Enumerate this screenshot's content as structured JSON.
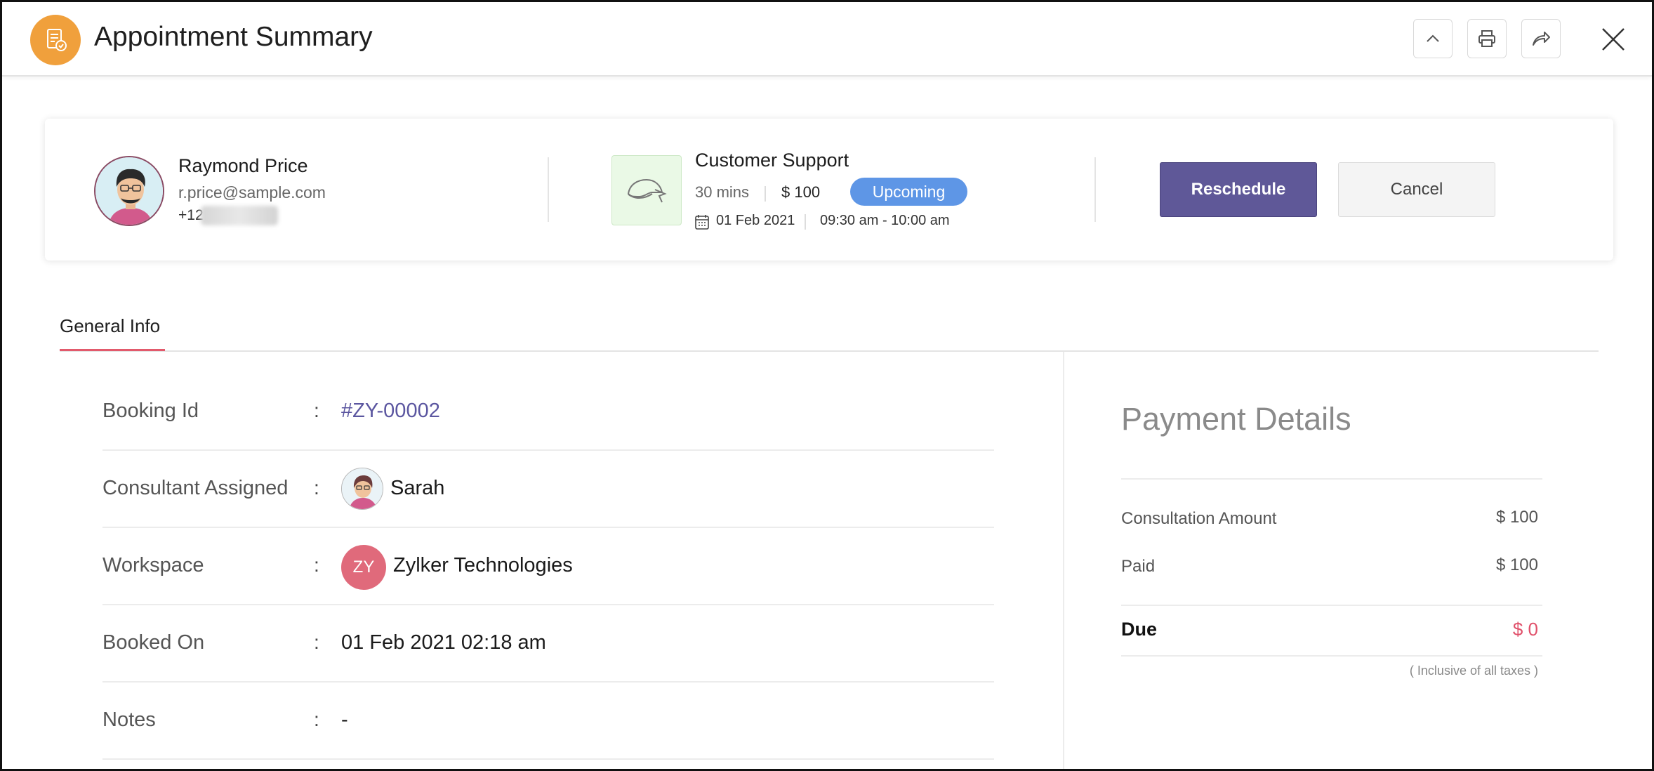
{
  "header": {
    "title": "Appointment Summary",
    "icon": "appointment-doc-icon",
    "accent_color": "#f0a03c"
  },
  "customer": {
    "name": "Raymond Price",
    "email": "r.price@sample.com",
    "phone_prefix": "+12"
  },
  "service": {
    "name": "Customer Support",
    "duration": "30 mins",
    "price": "$ 100",
    "status": "Upcoming",
    "status_color": "#5e96e6",
    "date": "01 Feb 2021",
    "time": "09:30 am - 10:00 am"
  },
  "actions": {
    "reschedule_label": "Reschedule",
    "cancel_label": "Cancel",
    "primary_color": "#5f5898"
  },
  "tabs": [
    {
      "label": "General Info",
      "active": true
    }
  ],
  "details": {
    "booking_id": {
      "label": "Booking Id",
      "value": "#ZY-00002"
    },
    "consultant": {
      "label": "Consultant Assigned",
      "value": "Sarah"
    },
    "workspace": {
      "label": "Workspace",
      "value": "Zylker Technologies",
      "initials": "ZY"
    },
    "booked_on": {
      "label": "Booked On",
      "value": "01 Feb 2021 02:18 am"
    },
    "notes": {
      "label": "Notes",
      "value": "-"
    },
    "separator": ":"
  },
  "payment": {
    "title": "Payment Details",
    "consultation_label": "Consultation Amount",
    "consultation_value": "$ 100",
    "paid_label": "Paid",
    "paid_value": "$ 100",
    "due_label": "Due",
    "due_value": "$ 0",
    "tax_note": "( Inclusive of all taxes )"
  }
}
